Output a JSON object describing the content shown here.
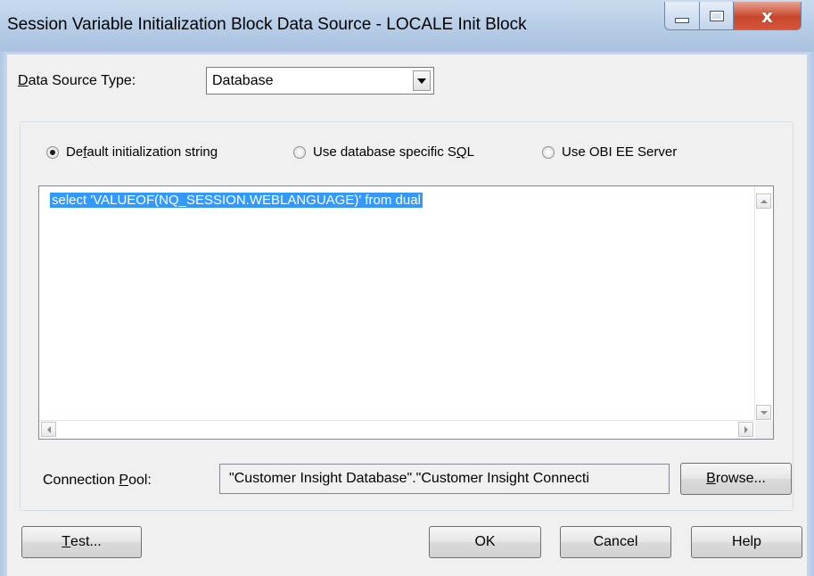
{
  "window": {
    "title": "Session Variable Initialization Block Data Source - LOCALE Init Block",
    "controls": {
      "minimize_icon": "minimize-icon",
      "maximize_icon": "maximize-icon",
      "close_glyph": "x"
    }
  },
  "data_source_type": {
    "label_prefix": "",
    "label_hotkey": "D",
    "label_rest": "ata Source Type:",
    "value": "Database"
  },
  "init_string": {
    "options": [
      {
        "pre": "De",
        "hotkey": "f",
        "post": "ault initialization string",
        "selected": true
      },
      {
        "pre": "Use database specific S",
        "hotkey": "Q",
        "post": "L",
        "selected": false
      },
      {
        "pre": "Use OBI EE Server",
        "hotkey": "",
        "post": "",
        "selected": false
      }
    ],
    "sql": "select 'VALUEOF(NQ_SESSION.WEBLANGUAGE)' from dual"
  },
  "connection_pool": {
    "label_pre": "Connection ",
    "label_hotkey": "P",
    "label_post": "ool:",
    "value": "\"Customer Insight Database\".\"Customer Insight Connecti"
  },
  "buttons": {
    "browse": {
      "hotkey": "B",
      "rest": "rowse..."
    },
    "test": {
      "hotkey": "T",
      "rest": "est..."
    },
    "ok": "OK",
    "cancel": "Cancel",
    "help": "Help"
  }
}
